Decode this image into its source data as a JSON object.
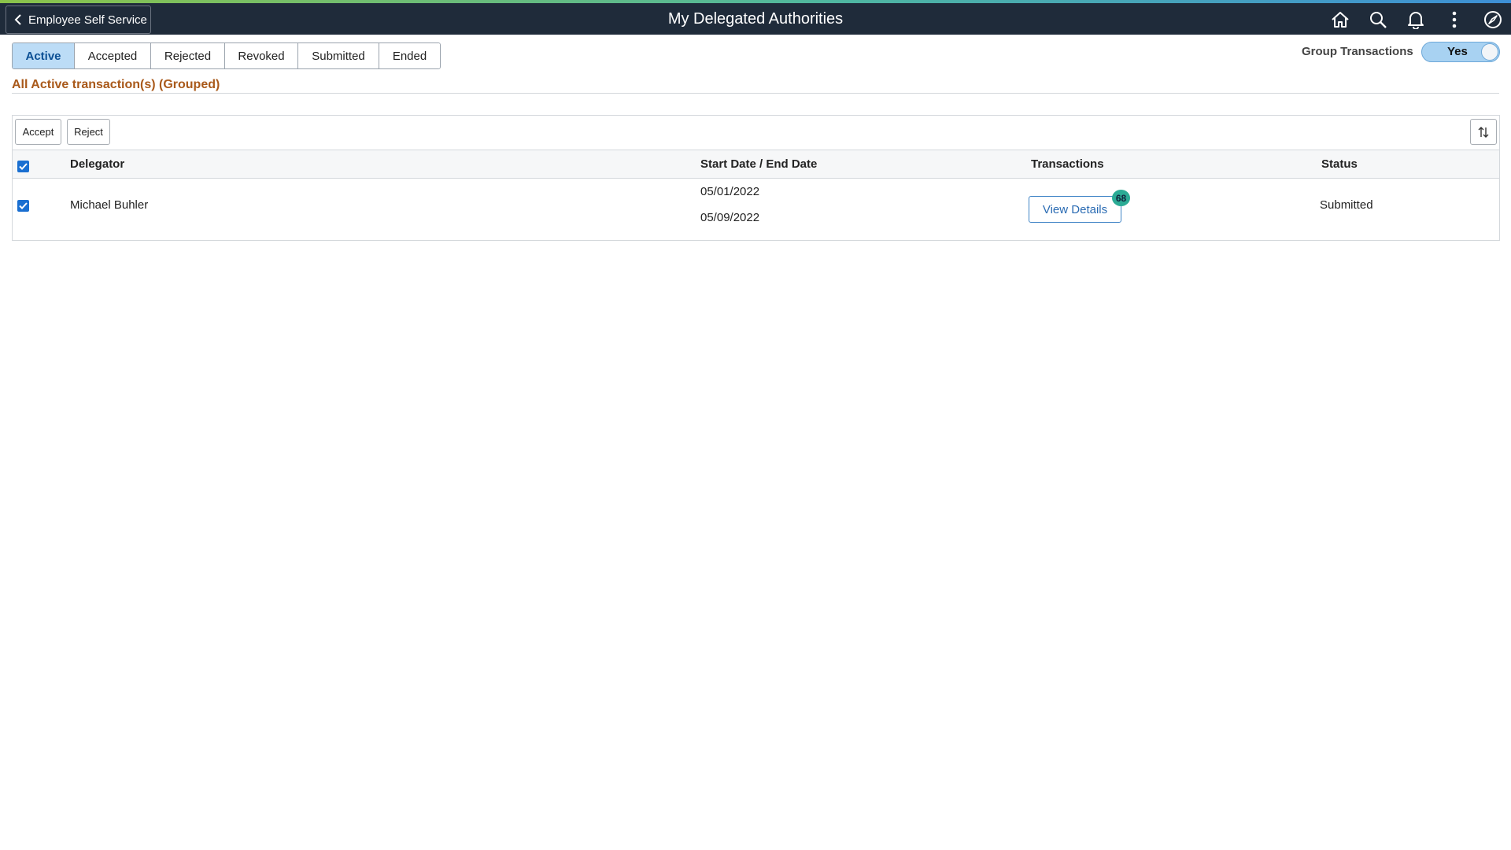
{
  "header": {
    "back_label": "Employee Self Service",
    "title": "My Delegated Authorities",
    "icons": [
      "home-icon",
      "search-icon",
      "bell-icon",
      "more-vertical-icon",
      "navbar-compass-icon"
    ]
  },
  "tabs": [
    {
      "label": "Active",
      "selected": true
    },
    {
      "label": "Accepted",
      "selected": false
    },
    {
      "label": "Rejected",
      "selected": false
    },
    {
      "label": "Revoked",
      "selected": false
    },
    {
      "label": "Submitted",
      "selected": false
    },
    {
      "label": "Ended",
      "selected": false
    }
  ],
  "group_transactions": {
    "label": "Group Transactions",
    "value": "Yes"
  },
  "section": {
    "title": "All Active transaction(s) (Grouped)"
  },
  "toolbar": {
    "accept_label": "Accept",
    "reject_label": "Reject",
    "sort_icon": "sort-icon"
  },
  "grid": {
    "columns": {
      "delegator": "Delegator",
      "dates": "Start Date / End Date",
      "transactions": "Transactions",
      "status": "Status"
    },
    "select_all_checked": true,
    "rows": [
      {
        "checked": true,
        "delegator": "Michael Buhler",
        "start_date": "05/01/2022",
        "end_date": "05/09/2022",
        "transactions_label": "View Details",
        "transactions_count": "68",
        "status": "Submitted"
      }
    ]
  },
  "colors": {
    "header_bg": "#1f2b3a",
    "section_title": "#a9591a",
    "tab_active_bg": "#bcdcf6",
    "badge": "#2bab95",
    "checkbox": "#1a6fd1"
  }
}
